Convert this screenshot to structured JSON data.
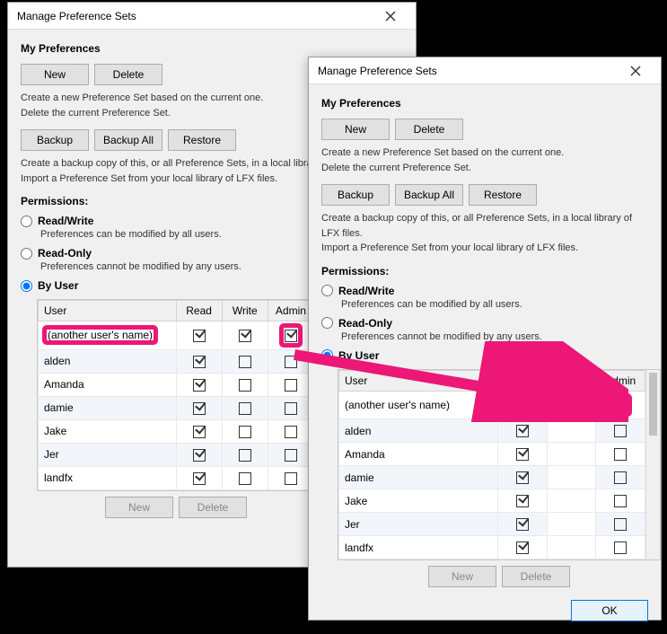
{
  "dialog_title": "Manage Preference Sets",
  "section_my_prefs": "My Preferences",
  "buttons": {
    "new": "New",
    "delete": "Delete",
    "backup": "Backup",
    "backup_all": "Backup All",
    "restore": "Restore",
    "ok": "OK"
  },
  "desc_new_delete_1": "Create a new Preference Set based on the current one.",
  "desc_new_delete_2": "Delete the current Preference Set.",
  "desc_backup_1": "Create a backup copy of this, or all Preference Sets, in a local library of LFX files.",
  "desc_backup_2": "Import a Preference Set from your local library of LFX files.",
  "permissions": {
    "label": "Permissions:",
    "read_write": "Read/Write",
    "read_write_desc": "Preferences can be modified by all users.",
    "read_only": "Read-Only",
    "read_only_desc": "Preferences cannot be modified by any users.",
    "by_user": "By User"
  },
  "table": {
    "headers": {
      "user": "User",
      "read": "Read",
      "write": "Write",
      "admin": "Admin"
    },
    "rows_left": [
      {
        "user": "(another user's name)",
        "read": true,
        "write": true,
        "admin": true,
        "hl_user": true,
        "hl_admin": true
      },
      {
        "user": "alden",
        "read": true,
        "write": false,
        "admin": false
      },
      {
        "user": "Amanda",
        "read": true,
        "write": false,
        "admin": false
      },
      {
        "user": "damie",
        "read": true,
        "write": false,
        "admin": false
      },
      {
        "user": "Jake",
        "read": true,
        "write": false,
        "admin": false
      },
      {
        "user": "Jer",
        "read": true,
        "write": false,
        "admin": false
      },
      {
        "user": "landfx",
        "read": true,
        "write": false,
        "admin": false
      }
    ],
    "rows_right": [
      {
        "user": "(another user's name)",
        "read": true,
        "write": false,
        "admin": false,
        "hl_admin": true
      },
      {
        "user": "alden",
        "read": true,
        "write": false,
        "admin": false
      },
      {
        "user": "Amanda",
        "read": true,
        "write": false,
        "admin": false
      },
      {
        "user": "damie",
        "read": true,
        "write": false,
        "admin": false
      },
      {
        "user": "Jake",
        "read": true,
        "write": false,
        "admin": false
      },
      {
        "user": "Jer",
        "read": true,
        "write": false,
        "admin": false
      },
      {
        "user": "landfx",
        "read": true,
        "write": false,
        "admin": false
      }
    ]
  },
  "left_dialog_desc_backup_1_short": "Create a backup copy of this, or all Preference Sets, in a local libra"
}
